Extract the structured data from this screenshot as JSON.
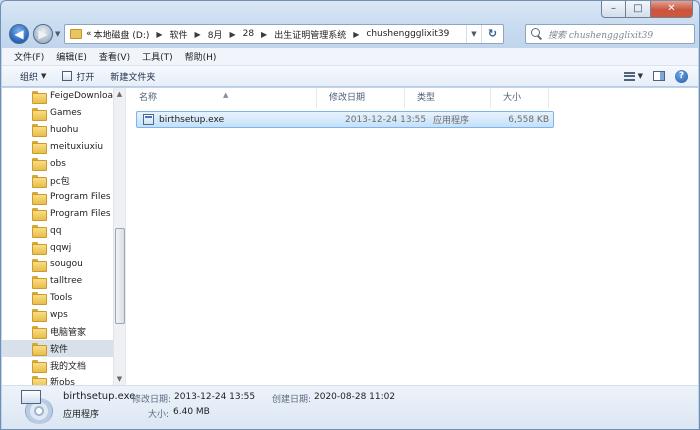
{
  "caption": {
    "minimize": "–",
    "maximize": "□",
    "close": "✕"
  },
  "nav": {
    "back": "◀",
    "forward": "▶",
    "dropdown": "▼"
  },
  "address": {
    "chevron": "«",
    "crumbs": [
      "本地磁盘 (D:)",
      "软件",
      "8月",
      "28",
      "出生证明管理系统",
      "chushenggglixit39"
    ],
    "separator": "▶",
    "dropdown": "▼",
    "refresh": "↻"
  },
  "search": {
    "placeholder": "搜索 chushenggglixit39"
  },
  "menu": [
    "文件(F)",
    "编辑(E)",
    "查看(V)",
    "工具(T)",
    "帮助(H)"
  ],
  "toolbar": {
    "organize": "组织",
    "organize_arrow": "▼",
    "open": "打开",
    "new_folder": "新建文件夹",
    "view_arrow": "▼",
    "help": "?"
  },
  "tree": [
    "FeigeDownloa",
    "Games",
    "huohu",
    "meituxiuxiu",
    "obs",
    "pc包",
    "Program Files",
    "Program Files",
    "qq",
    "qqwj",
    "sougou",
    "talltree",
    "Tools",
    "wps",
    "电脑管家",
    "软件",
    "我的文档",
    "新obs"
  ],
  "tree_selected": "软件",
  "scrollbar": {
    "up": "▲",
    "down": "▼"
  },
  "columns": {
    "name": "名称",
    "date": "修改日期",
    "type": "类型",
    "size": "大小",
    "sort_indicator": "▲"
  },
  "files": [
    {
      "name": "birthsetup.exe",
      "date": "2013-12-24 13:55",
      "type": "应用程序",
      "size": "6,558 KB"
    }
  ],
  "details": {
    "filename": "birthsetup.exe",
    "type": "应用程序",
    "modified_label": "修改日期:",
    "modified_value": "2013-12-24 13:55",
    "created_label": "创建日期:",
    "created_value": "2020-08-28 11:02",
    "size_label": "大小:",
    "size_value": "6.40 MB"
  }
}
